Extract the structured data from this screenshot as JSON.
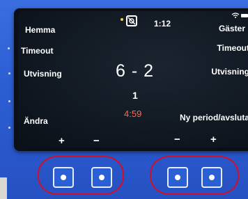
{
  "top_bar": {
    "time": "1:12",
    "status_icon": "no-whistle-icon",
    "wifi_icon": "wifi-icon",
    "battery_icon": "battery-icon"
  },
  "home": {
    "label": "Hemma",
    "timeout_label": "Timeout",
    "penalty_label": "Utvisning",
    "change_label": "Ändra",
    "plus": "+",
    "minus": "−"
  },
  "away": {
    "label": "Gäster",
    "timeout_label": "Timeout",
    "penalty_label": "Utvisning",
    "new_period_label": "Ny period/avsluta",
    "plus": "+",
    "minus": "−"
  },
  "score": {
    "display": "6 - 2",
    "home": 6,
    "away": 2
  },
  "period": "1",
  "clock": "4:59",
  "colors": {
    "device_blue": "#2c5fd4",
    "clock_red": "#ff6a4d",
    "highlight_red": "#d0102a"
  }
}
